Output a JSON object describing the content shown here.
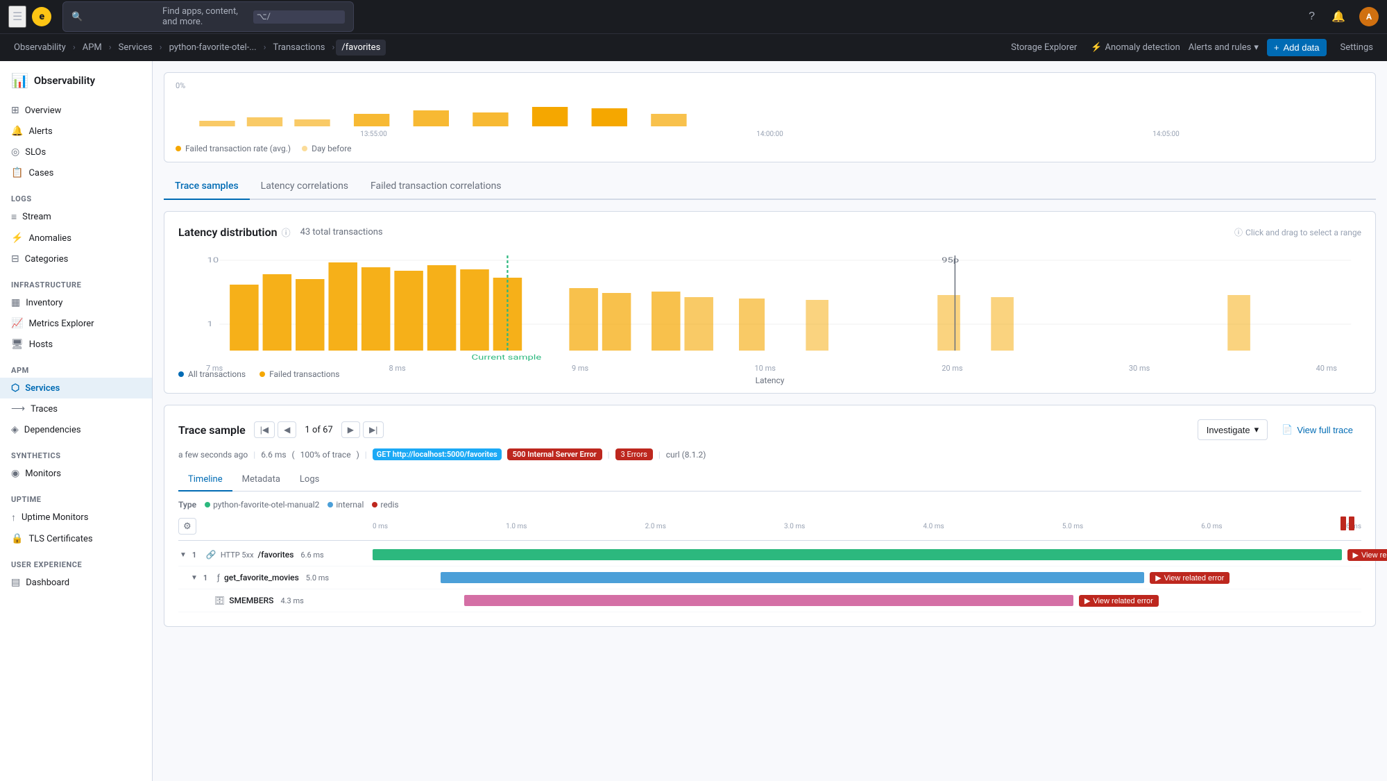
{
  "app": {
    "logo_letter": "e",
    "name": "elastic"
  },
  "search": {
    "placeholder": "Find apps, content, and more.",
    "shortcut": "⌥/"
  },
  "breadcrumbs": [
    {
      "label": "Observability",
      "active": false
    },
    {
      "label": "APM",
      "active": false
    },
    {
      "label": "Services",
      "active": false
    },
    {
      "label": "python-favorite-otel-...",
      "active": false
    },
    {
      "label": "Transactions",
      "active": false
    },
    {
      "label": "/favorites",
      "active": true
    }
  ],
  "nav_right": {
    "storage_explorer": "Storage Explorer",
    "anomaly_detection": "Anomaly detection",
    "alerts_and_rules": "Alerts and rules",
    "add_data": "Add data",
    "settings": "Settings"
  },
  "sidebar": {
    "app_title": "Observability",
    "sections": [
      {
        "items": [
          {
            "label": "Overview",
            "icon": "⊞",
            "active": false
          },
          {
            "label": "Alerts",
            "icon": "🔔",
            "active": false
          },
          {
            "label": "SLOs",
            "icon": "◎",
            "active": false
          },
          {
            "label": "Cases",
            "icon": "📋",
            "active": false
          }
        ]
      },
      {
        "label": "Logs",
        "items": [
          {
            "label": "Stream",
            "icon": "≡",
            "active": false
          },
          {
            "label": "Anomalies",
            "icon": "⚡",
            "active": false
          },
          {
            "label": "Categories",
            "icon": "⊟",
            "active": false
          }
        ]
      },
      {
        "label": "Infrastructure",
        "items": [
          {
            "label": "Inventory",
            "icon": "▦",
            "active": false
          },
          {
            "label": "Metrics Explorer",
            "icon": "📈",
            "active": false
          },
          {
            "label": "Hosts",
            "icon": "🖥",
            "active": false
          }
        ]
      },
      {
        "label": "APM",
        "items": [
          {
            "label": "Services",
            "icon": "⬡",
            "active": true
          },
          {
            "label": "Traces",
            "icon": "⟶",
            "active": false
          },
          {
            "label": "Dependencies",
            "icon": "◈",
            "active": false
          }
        ]
      },
      {
        "label": "Synthetics",
        "items": [
          {
            "label": "Monitors",
            "icon": "◉",
            "active": false
          }
        ]
      },
      {
        "label": "Uptime",
        "items": [
          {
            "label": "Uptime Monitors",
            "icon": "↑",
            "active": false
          },
          {
            "label": "TLS Certificates",
            "icon": "🔒",
            "active": false
          }
        ]
      },
      {
        "label": "User Experience",
        "items": [
          {
            "label": "Dashboard",
            "icon": "▤",
            "active": false
          }
        ]
      }
    ]
  },
  "chart_preview": {
    "x_labels": [
      "13:55:00",
      "14:00:00",
      "14:05:00"
    ],
    "legend": [
      {
        "label": "Failed transaction rate (avg.)",
        "color": "#F5A700"
      },
      {
        "label": "Day before",
        "color": "#F5A700"
      }
    ],
    "zero_label": "0%"
  },
  "main_tabs": [
    {
      "label": "Trace samples",
      "active": true
    },
    {
      "label": "Latency correlations",
      "active": false
    },
    {
      "label": "Failed transaction correlations",
      "active": false
    }
  ],
  "latency_distribution": {
    "title": "Latency distribution",
    "total_transactions": "43 total transactions",
    "drag_hint": "Click and drag to select a range",
    "y_max": "10",
    "y_mid": "1",
    "current_sample_label": "Current sample",
    "p95_label": "95p",
    "x_labels": [
      "7 ms",
      "8 ms",
      "9 ms",
      "10 ms",
      "20 ms",
      "30 ms",
      "40 ms"
    ],
    "x_axis_label": "Latency",
    "legend": [
      {
        "label": "All transactions",
        "color": "#006BB4"
      },
      {
        "label": "Failed transactions",
        "color": "#F5A700"
      }
    ]
  },
  "trace_sample": {
    "title": "Trace sample",
    "current": "1",
    "total": "67",
    "timestamp": "a few seconds ago",
    "duration": "6.6 ms",
    "trace_pct": "100% of trace",
    "http_method": "GET http://localhost:5000/favorites",
    "status_code": "500 Internal Server Error",
    "errors": "3 Errors",
    "agent": "curl (8.1.2)",
    "investigate_label": "Investigate",
    "view_full_trace": "View full trace"
  },
  "timeline_tabs": [
    {
      "label": "Timeline",
      "active": true
    },
    {
      "label": "Metadata",
      "active": false
    },
    {
      "label": "Logs",
      "active": false
    }
  ],
  "type_legend": [
    {
      "label": "python-favorite-otel-manual2",
      "color": "#2CB87E"
    },
    {
      "label": "internal",
      "color": "#4B9FD8"
    },
    {
      "label": "redis",
      "color": "#BD271E"
    }
  ],
  "timeline_ruler": {
    "ticks": [
      "0 ms",
      "1.0 ms",
      "2.0 ms",
      "3.0 ms",
      "4.0 ms",
      "5.0 ms",
      "6.0 ms",
      "6.6 ms"
    ]
  },
  "timeline_rows": [
    {
      "depth": 0,
      "expand": true,
      "count": 1,
      "icon": "http",
      "method": "HTTP 5xx",
      "name": "/favorites",
      "duration": "6.6 ms",
      "bar_left": "0%",
      "bar_width": "100%",
      "bar_color": "#2CB87E",
      "has_error": true,
      "error_label": "View related error"
    },
    {
      "depth": 1,
      "expand": true,
      "count": 1,
      "icon": "fn",
      "method": "",
      "name": "get_favorite_movies",
      "duration": "5.0 ms",
      "bar_left": "5.8%",
      "bar_width": "75.7%",
      "bar_color": "#4B9FD8",
      "has_error": true,
      "error_label": "View related error"
    },
    {
      "depth": 2,
      "expand": false,
      "count": null,
      "icon": "db",
      "method": "",
      "name": "SMEMBERS",
      "duration": "4.3 ms",
      "bar_left": "7.2%",
      "bar_width": "65.1%",
      "bar_color": "#D46FA5",
      "has_error": true,
      "error_label": "View related error"
    }
  ]
}
